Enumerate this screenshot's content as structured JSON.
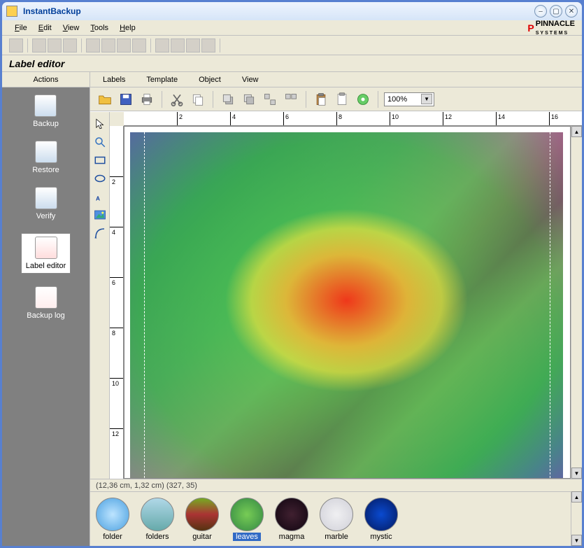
{
  "window": {
    "title": "InstantBackup"
  },
  "menu": {
    "file": "File",
    "edit": "Edit",
    "view": "View",
    "tools": "Tools",
    "help": "Help"
  },
  "brand": {
    "name": "PINNACLE",
    "sub": "SYSTEMS"
  },
  "section": {
    "title": "Label editor"
  },
  "sidebar": {
    "header": "Actions",
    "items": [
      {
        "label": "Backup"
      },
      {
        "label": "Restore"
      },
      {
        "label": "Verify"
      },
      {
        "label": "Label editor"
      },
      {
        "label": "Backup log"
      }
    ],
    "selected": 3
  },
  "submenu": {
    "labels": "Labels",
    "template": "Template",
    "object": "Object",
    "view": "View"
  },
  "toolbar": {
    "open": "open",
    "save": "save",
    "print": "print",
    "cut": "cut",
    "copy": "copy",
    "bring_front": "bring-front",
    "send_back": "send-back",
    "paste": "paste",
    "clipboard": "clipboard",
    "disc": "disc"
  },
  "zoom": {
    "value": "100%"
  },
  "tools": {
    "pointer": "pointer",
    "zoom": "zoom",
    "rect": "rectangle",
    "ellipse": "ellipse",
    "text": "text",
    "image": "image",
    "curve": "curve"
  },
  "ruler": {
    "h": [
      "2",
      "4",
      "6",
      "8",
      "10",
      "12",
      "14",
      "16"
    ],
    "v": [
      "2",
      "4",
      "6",
      "8",
      "10",
      "12"
    ]
  },
  "status": {
    "text": "(12,36 cm, 1,32 cm) (327, 35)"
  },
  "thumbs": {
    "items": [
      {
        "label": "folder",
        "bg": "radial-gradient(#bde4ff,#4aa0e0)"
      },
      {
        "label": "folders",
        "bg": "linear-gradient(#b0d8e8,#6aa)"
      },
      {
        "label": "guitar",
        "bg": "linear-gradient(#7a2,#a33 50%,#531)"
      },
      {
        "label": "leaves",
        "bg": "radial-gradient(#7c5,#384)"
      },
      {
        "label": "magma",
        "bg": "radial-gradient(#402030,#100510)"
      },
      {
        "label": "marble",
        "bg": "radial-gradient(#f0f0f2,#d0d0d8)"
      },
      {
        "label": "mystic",
        "bg": "radial-gradient(#0a4ad0,#041a60)"
      }
    ],
    "selected": 3
  }
}
